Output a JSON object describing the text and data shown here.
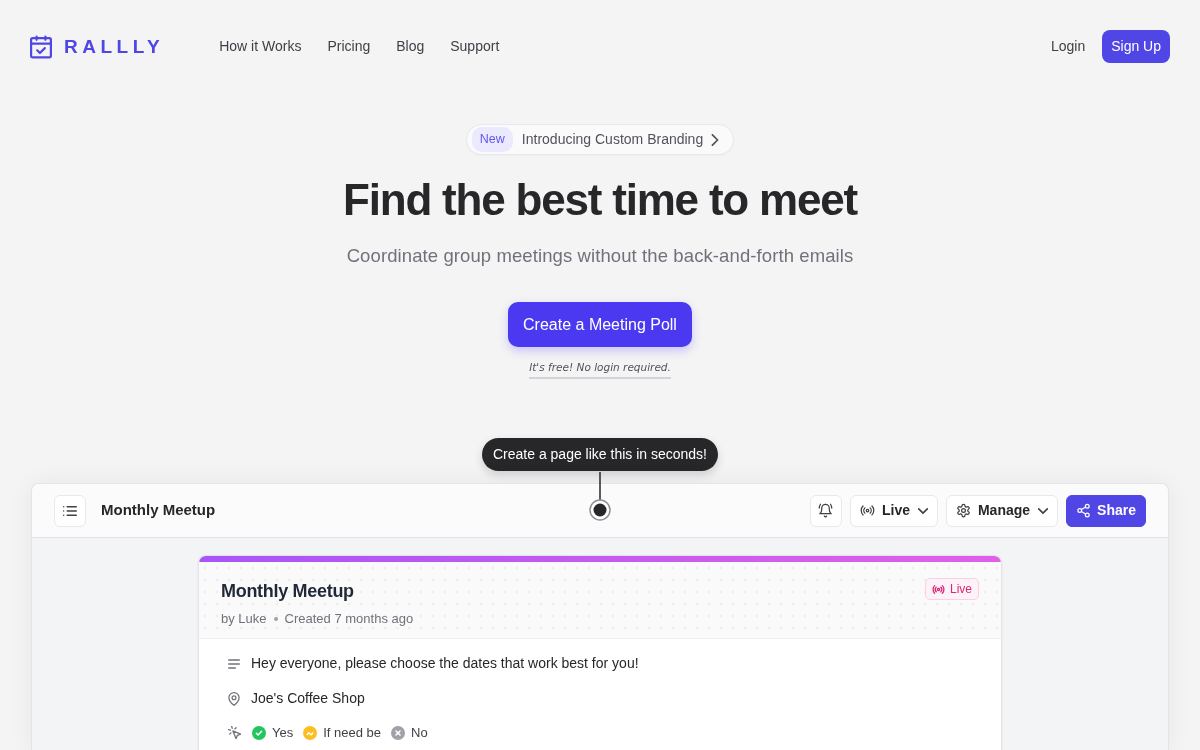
{
  "brand": {
    "name": "RALLLY"
  },
  "nav": {
    "links": [
      "How it Works",
      "Pricing",
      "Blog",
      "Support"
    ],
    "login": "Login",
    "sign_up": "Sign Up"
  },
  "announcement": {
    "badge": "New",
    "text": "Introducing Custom Branding"
  },
  "hero": {
    "title": "Find the best time to meet",
    "subtitle": "Coordinate group meetings without the back-and-forth emails",
    "cta": "Create a Meeting Poll",
    "note": "It's free! No login required."
  },
  "tooltip": "Create a page like this in seconds!",
  "preview": {
    "title": "Monthly Meetup",
    "toolbar": [
      {
        "kind": "icon"
      },
      {
        "kind": "dropdown",
        "label": "Live"
      },
      {
        "kind": "dropdown",
        "label": "Manage"
      },
      {
        "kind": "primary",
        "label": "Share"
      }
    ]
  },
  "poll": {
    "title": "Monthly Meetup",
    "author": "by Luke",
    "created": "Created 7 months ago",
    "status": "Live",
    "description": "Hey everyone, please choose the dates that work best for you!",
    "location": "Joe's Coffee Shop",
    "legend": [
      {
        "kind": "yes",
        "label": "Yes",
        "color": "#22c55e"
      },
      {
        "kind": "ifneedbe",
        "label": "If need be",
        "color": "#fbbf24"
      },
      {
        "kind": "no",
        "label": "No",
        "color": "#a1a1aa"
      }
    ]
  }
}
